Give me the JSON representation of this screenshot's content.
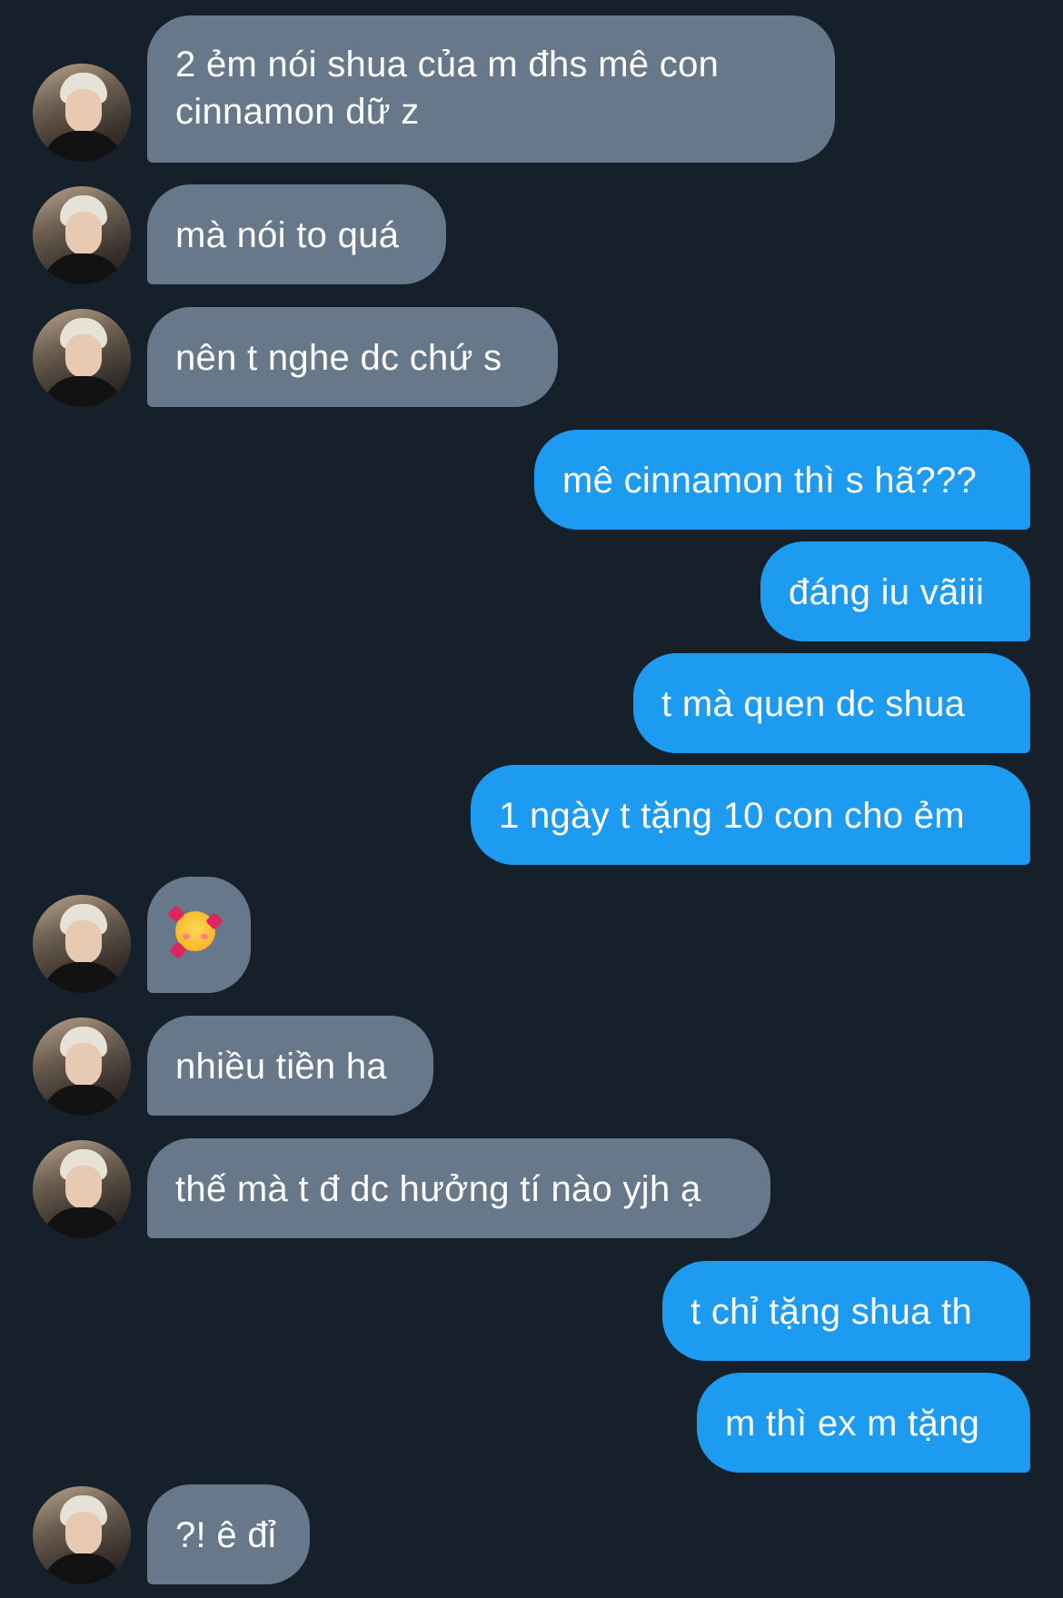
{
  "conversation": {
    "messages": [
      {
        "id": "m1",
        "direction": "incoming",
        "text": "2 ẻm nói shua của m đhs mê con\ncinnamon dữ z"
      },
      {
        "id": "m2",
        "direction": "incoming",
        "text": "mà nói to quá"
      },
      {
        "id": "m3",
        "direction": "incoming",
        "text": "nên t nghe dc chứ s"
      },
      {
        "id": "m4",
        "direction": "outgoing",
        "text": "mê cinnamon thì s hã???"
      },
      {
        "id": "m5",
        "direction": "outgoing",
        "text": "đáng iu vãiii"
      },
      {
        "id": "m6",
        "direction": "outgoing",
        "text": "t mà quen dc shua"
      },
      {
        "id": "m7",
        "direction": "outgoing",
        "text": "1 ngày t tặng 10 con cho ẻm"
      },
      {
        "id": "m8",
        "direction": "incoming",
        "emoji": "smiling-face-with-hearts"
      },
      {
        "id": "m9",
        "direction": "incoming",
        "text": "nhiều tiền ha"
      },
      {
        "id": "m10",
        "direction": "incoming",
        "text": "thế mà t đ dc hưởng tí nào yjh ạ"
      },
      {
        "id": "m11",
        "direction": "outgoing",
        "text": "t chỉ tặng shua th"
      },
      {
        "id": "m12",
        "direction": "outgoing",
        "text": "m thì ex m tặng"
      },
      {
        "id": "m13",
        "direction": "incoming",
        "text": "?! ê đỉ"
      }
    ]
  },
  "colors": {
    "background": "#15202b",
    "incoming_bubble": "#66788a",
    "outgoing_bubble": "#1d9bf0",
    "text": "#ffffff"
  }
}
